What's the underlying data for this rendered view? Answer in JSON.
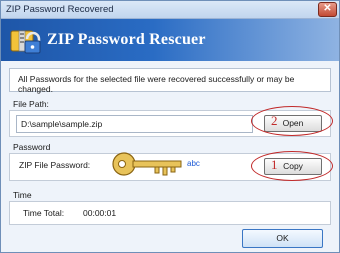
{
  "window": {
    "title": "ZIP Password Recovered",
    "close_glyph": "✕"
  },
  "header": {
    "app_title": "ZIP Password Rescuer",
    "logo_icon": "zip-lock-icon"
  },
  "notice": "All Passwords for the selected file were recovered successfully or may be changed.",
  "file_path": {
    "section_label": "File Path:",
    "value": "D:\\sample\\sample.zip",
    "open_button": "Open",
    "annotation_number": "2"
  },
  "password": {
    "section_label": "Password",
    "field_label": "ZIP File Password:",
    "value": "abc",
    "copy_button": "Copy",
    "annotation_number": "1",
    "key_icon": "key-icon"
  },
  "time": {
    "section_label": "Time",
    "total_label": "Time Total:",
    "total_value": "00:00:01"
  },
  "footer": {
    "ok_button": "OK"
  },
  "colors": {
    "annotation": "#c12a2a",
    "header_blue": "#2a6cc4",
    "link_blue": "#1e5bd6"
  }
}
